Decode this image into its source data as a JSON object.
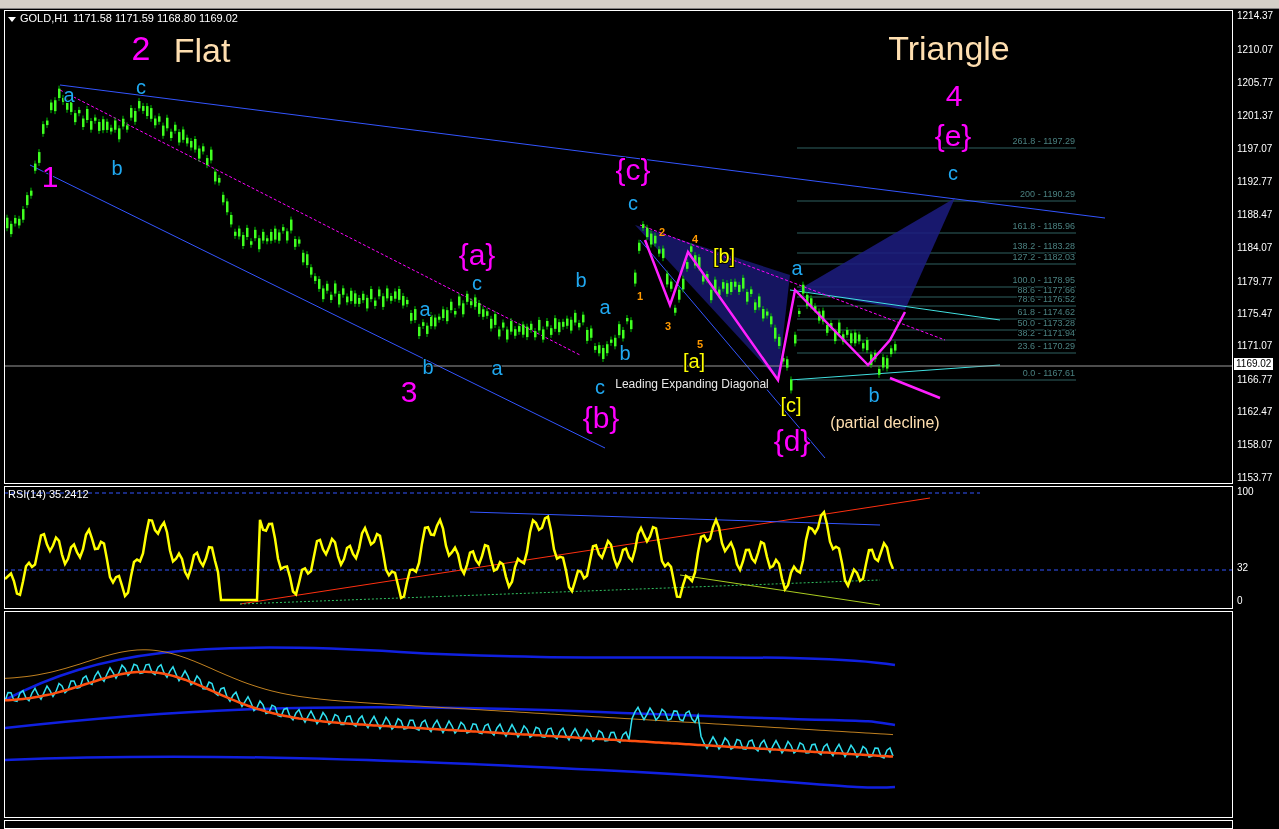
{
  "chart": {
    "symbol": "GOLD,H1",
    "ohlc": "1171.58 1171.59 1168.80 1169.02",
    "price_axis": [
      "1214.37",
      "1210.07",
      "1205.77",
      "1201.37",
      "1197.07",
      "1192.77",
      "1188.47",
      "1184.07",
      "1179.77",
      "1175.47",
      "1171.07",
      "1166.77",
      "1162.47",
      "1158.07",
      "1153.77"
    ],
    "current_price": "1169.02",
    "labels": [
      {
        "text": "2",
        "color": "#ff00ff",
        "kind": "title"
      },
      {
        "text": "Flat",
        "color": "#ffdfb0",
        "kind": "title"
      },
      {
        "text": "a",
        "color": "#20a8f0",
        "kind": "minor"
      },
      {
        "text": "c",
        "color": "#20a8f0",
        "kind": "minor"
      },
      {
        "text": "b",
        "color": "#20a8f0",
        "kind": "minor"
      },
      {
        "text": "1",
        "color": "#ff00ff",
        "kind": "wave"
      },
      {
        "text": "{a}",
        "color": "#ff00ff",
        "kind": "wave"
      },
      {
        "text": "c",
        "color": "#20a8f0",
        "kind": "minor"
      },
      {
        "text": "a",
        "color": "#20a8f0",
        "kind": "minor"
      },
      {
        "text": "b",
        "color": "#20a8f0",
        "kind": "minor"
      },
      {
        "text": "a",
        "color": "#20a8f0",
        "kind": "minor"
      },
      {
        "text": "3",
        "color": "#ff00ff",
        "kind": "wave"
      },
      {
        "text": "b",
        "color": "#20a8f0",
        "kind": "minor"
      },
      {
        "text": "a",
        "color": "#20a8f0",
        "kind": "minor"
      },
      {
        "text": "b",
        "color": "#20a8f0",
        "kind": "minor"
      },
      {
        "text": "c",
        "color": "#20a8f0",
        "kind": "minor"
      },
      {
        "text": "{b}",
        "color": "#ff00ff",
        "kind": "wave"
      },
      {
        "text": "{c}",
        "color": "#ff00ff",
        "kind": "wave"
      },
      {
        "text": "c",
        "color": "#20a8f0",
        "kind": "minor"
      },
      {
        "text": "1",
        "color": "#ff9900",
        "kind": "count"
      },
      {
        "text": "2",
        "color": "#ff9900",
        "kind": "count"
      },
      {
        "text": "3",
        "color": "#ff9900",
        "kind": "count"
      },
      {
        "text": "4",
        "color": "#ff9900",
        "kind": "count"
      },
      {
        "text": "5",
        "color": "#ff9900",
        "kind": "count"
      },
      {
        "text": "[b]",
        "color": "#ffff00",
        "kind": "minor"
      },
      {
        "text": "[a]",
        "color": "#ffff00",
        "kind": "minor"
      },
      {
        "text": "Leading Expanding Diagonal",
        "color": "#e8e8e8",
        "kind": "note"
      },
      {
        "text": "a",
        "color": "#20a8f0",
        "kind": "minor"
      },
      {
        "text": "[c]",
        "color": "#ffff00",
        "kind": "minor"
      },
      {
        "text": "{d}",
        "color": "#ff00ff",
        "kind": "wave"
      },
      {
        "text": "b",
        "color": "#20a8f0",
        "kind": "minor"
      },
      {
        "text": "(partial decline)",
        "color": "#ffdfb0",
        "kind": "comment"
      },
      {
        "text": "Triangle",
        "color": "#ffdfb0",
        "kind": "title"
      },
      {
        "text": "4",
        "color": "#ff00ff",
        "kind": "wave"
      },
      {
        "text": "{e}",
        "color": "#ff00ff",
        "kind": "wave"
      },
      {
        "text": "c",
        "color": "#20a8f0",
        "kind": "minor"
      }
    ],
    "fib_levels": [
      "261.8 - 1197.29",
      "200 - 1190.29",
      "161.8 - 1185.96",
      "138.2 - 1183.28",
      "127.2 - 1182.03",
      "100.0 - 1178.95",
      "88.6 - 1177.66",
      "78.6 - 1176.52",
      "61.8 - 1174.62",
      "50.0 - 1173.28",
      "38.2 - 1171.94",
      "23.6  - 1170.29",
      "0.0 - 1167.61"
    ]
  },
  "rsi": {
    "title": "RSI(14) 35.2412",
    "axis": [
      "100",
      "32",
      "0"
    ]
  }
}
